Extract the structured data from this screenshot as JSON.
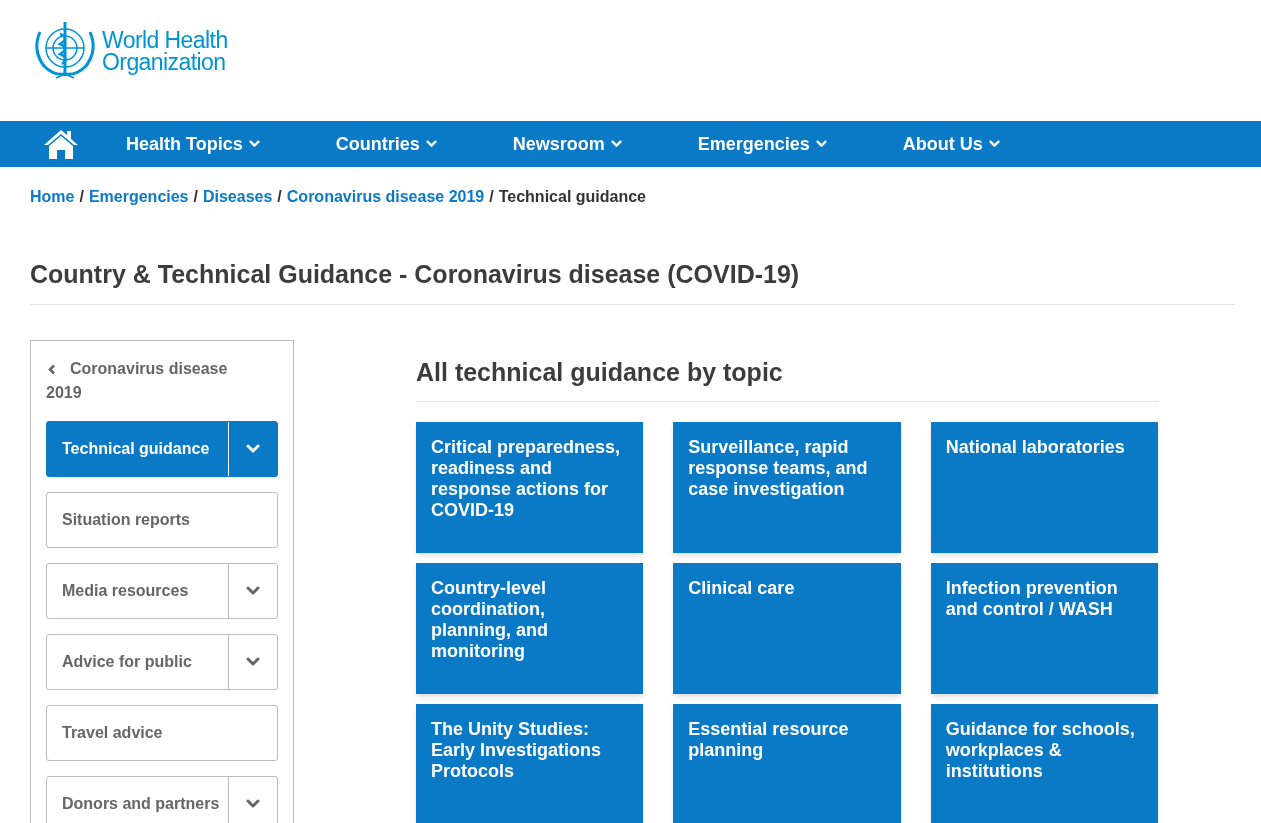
{
  "logo": {
    "line_1": "World Health",
    "line_2": "Organization"
  },
  "nav": {
    "items": [
      {
        "label": "Health Topics"
      },
      {
        "label": "Countries"
      },
      {
        "label": "Newsroom"
      },
      {
        "label": "Emergencies"
      },
      {
        "label": "About Us"
      }
    ]
  },
  "breadcrumb": {
    "links": [
      "Home",
      "Emergencies",
      "Diseases",
      "Coronavirus disease 2019"
    ],
    "current": "Technical guidance",
    "separator": "/"
  },
  "page_title": "Country & Technical Guidance - Coronavirus disease (COVID-19)",
  "sidebar": {
    "back_link": "Coronavirus disease 2019",
    "items": [
      {
        "label": "Technical guidance",
        "selected": true,
        "expandable": true
      },
      {
        "label": "Situation reports",
        "selected": false,
        "expandable": false
      },
      {
        "label": "Media resources",
        "selected": false,
        "expandable": true
      },
      {
        "label": "Advice for public",
        "selected": false,
        "expandable": true
      },
      {
        "label": "Travel advice",
        "selected": false,
        "expandable": false
      },
      {
        "label": "Donors and partners",
        "selected": false,
        "expandable": true
      }
    ]
  },
  "topics": {
    "heading": "All technical guidance by topic",
    "tiles": [
      "Critical preparedness, readiness and response actions for COVID-19",
      "Surveillance, rapid response teams, and case investigation",
      "National laboratories",
      "Country-level coordination, planning, and monitoring",
      "Clinical care",
      "Infection prevention and control / WASH",
      "The Unity Studies: Early Investigations Protocols",
      "Essential resource planning",
      "Guidance for schools, workplaces & institutions"
    ]
  }
}
